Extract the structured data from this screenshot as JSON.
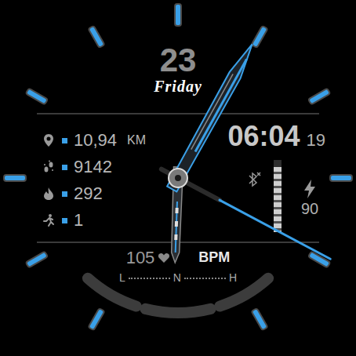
{
  "date": {
    "day": "23",
    "weekday": "Friday"
  },
  "stats": [
    {
      "kind": "distance",
      "value": "10,94",
      "unit": "KM"
    },
    {
      "kind": "steps",
      "value": "9142"
    },
    {
      "kind": "calories",
      "value": "292"
    },
    {
      "kind": "activity",
      "value": "1"
    }
  ],
  "time": {
    "hm": "06:04",
    "seconds": "19"
  },
  "bluetooth": {
    "connected": false
  },
  "battery": {
    "level": 0.9,
    "reading": "90"
  },
  "heart_rate": {
    "value": "105",
    "unit": "BPM"
  },
  "scale": {
    "labels": [
      "L",
      "N",
      "H"
    ]
  },
  "hands": {
    "hour": 182,
    "minute": 29,
    "second": 118
  }
}
